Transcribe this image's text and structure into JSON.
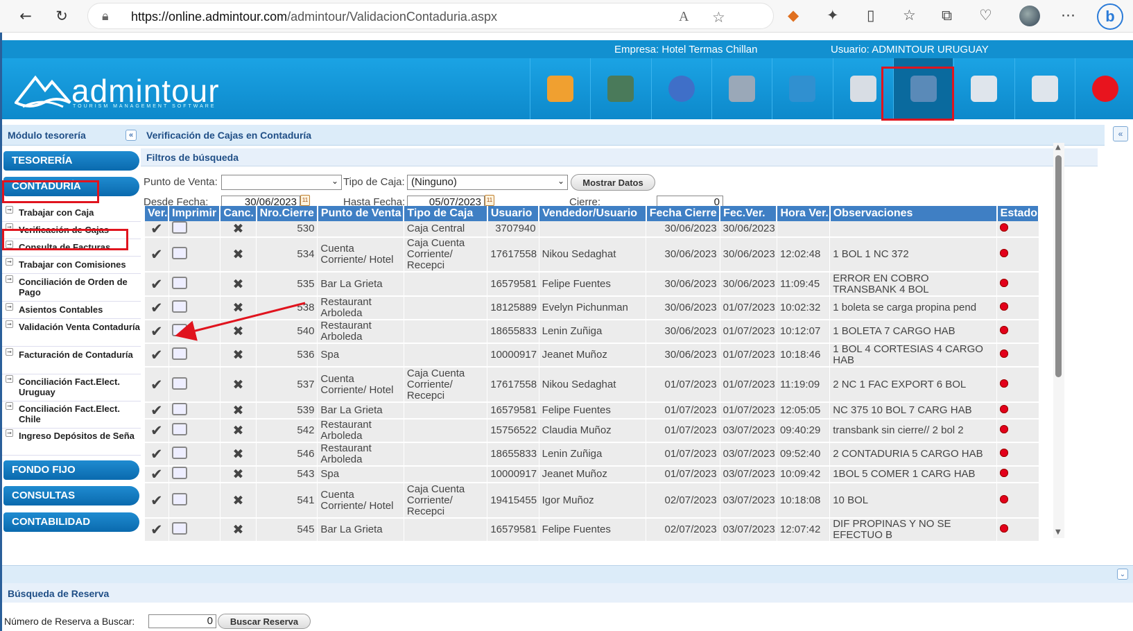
{
  "browser": {
    "url_host": "https://online.admintour.com",
    "url_path": "/admintour/ValidacionContaduria.aspx",
    "read_aloud": "A",
    "bing": "b"
  },
  "header": {
    "empresa": "Empresa: Hotel Termas Chillan",
    "usuario": "Usuario: ADMINTOUR URUGUAY",
    "logo_text": "admintour",
    "logo_sub": "TOURISM MANAGEMENT SOFTWARE",
    "modules": [
      {
        "icon": "home-icon",
        "color": "#f0a030"
      },
      {
        "icon": "building-icon",
        "color": "#4a7a5a"
      },
      {
        "icon": "restaurant-icon",
        "color": "#3f6fc8"
      },
      {
        "icon": "cart-icon",
        "color": "#9aa8b8"
      },
      {
        "icon": "user-desk-icon",
        "color": "#3090d0"
      },
      {
        "icon": "bank-icon",
        "color": "#d8dde4"
      },
      {
        "icon": "piggy-bank-icon",
        "color": "#5a8ab8"
      },
      {
        "icon": "calculator-icon",
        "color": "#dfe5ec"
      },
      {
        "icon": "tools-icon",
        "color": "#dfe5ec"
      },
      {
        "icon": "power-icon",
        "color": "#e8141e"
      }
    ]
  },
  "sidebar": {
    "title": "Módulo tesorería",
    "sections": {
      "tesoreria": "TESORERÍA",
      "contaduria": "CONTADURÍA",
      "fondo_fijo": "FONDO FIJO",
      "consultas": "CONSULTAS",
      "contabilidad": "CONTABILIDAD"
    },
    "items": [
      "Trabajar con Caja",
      "Verificación de Cajas",
      "Consulta de Facturas",
      "Trabajar con Comisiones",
      "Conciliación de Orden de Pago",
      "Asientos Contables",
      "Validación Venta Contaduría",
      "Facturación de Contaduría",
      "Conciliación Fact.Elect. Uruguay",
      "Conciliación Fact.Elect. Chile",
      "Ingreso Depósitos de Seña"
    ]
  },
  "main": {
    "title": "Verificación de Cajas en Contaduría",
    "filters": {
      "title": "Filtros de búsqueda",
      "punto_venta_label": "Punto de Venta:",
      "punto_venta_value": "",
      "tipo_caja_label": "Tipo de Caja:",
      "tipo_caja_value": "(Ninguno)",
      "mostrar_btn": "Mostrar Datos",
      "desde_label": "Desde Fecha:",
      "desde_value": "30/06/2023",
      "hasta_label": "Hasta Fecha:",
      "hasta_value": "05/07/2023",
      "cierre_label": "Cierre:",
      "cierre_value": "0"
    },
    "columns": [
      "Ver.",
      "Imprimir",
      "Canc.",
      "Nro.Cierre",
      "Punto de Venta",
      "Tipo de Caja",
      "Usuario",
      "Vendedor/Usuario",
      "Fecha Cierre",
      "Fec.Ver.",
      "Hora Ver.",
      "Observaciones",
      "Estado"
    ],
    "rows": [
      {
        "cierre": "530",
        "punto": "",
        "tipo": "Caja Central",
        "usuario": "3707940",
        "vendedor": "",
        "fecha": "30/06/2023",
        "fecver": "30/06/2023",
        "hora": "",
        "obs": ""
      },
      {
        "cierre": "534",
        "punto": "Cuenta Corriente/ Hotel",
        "tipo": "Caja Cuenta Corriente/ Recepci",
        "usuario": "17617558",
        "vendedor": "Nikou Sedaghat",
        "fecha": "30/06/2023",
        "fecver": "30/06/2023",
        "hora": "12:02:48",
        "obs": "1 BOL 1 NC 372"
      },
      {
        "cierre": "535",
        "punto": "Bar La Grieta",
        "tipo": "",
        "usuario": "16579581",
        "vendedor": "Felipe Fuentes",
        "fecha": "30/06/2023",
        "fecver": "30/06/2023",
        "hora": "11:09:45",
        "obs": "ERROR EN COBRO TRANSBANK 4 BOL"
      },
      {
        "cierre": "538",
        "punto": "Restaurant Arboleda",
        "tipo": "",
        "usuario": "18125889",
        "vendedor": "Evelyn Pichunman",
        "fecha": "30/06/2023",
        "fecver": "01/07/2023",
        "hora": "10:02:32",
        "obs": "1 boleta se carga propina pend"
      },
      {
        "cierre": "540",
        "punto": "Restaurant Arboleda",
        "tipo": "",
        "usuario": "18655833",
        "vendedor": "Lenin Zuñiga",
        "fecha": "30/06/2023",
        "fecver": "01/07/2023",
        "hora": "10:12:07",
        "obs": "1 BOLETA 7 CARGO HAB"
      },
      {
        "cierre": "536",
        "punto": "Spa",
        "tipo": "",
        "usuario": "10000917",
        "vendedor": "Jeanet Muñoz",
        "fecha": "30/06/2023",
        "fecver": "01/07/2023",
        "hora": "10:18:46",
        "obs": "1 BOL 4 CORTESIAS 4 CARGO HAB"
      },
      {
        "cierre": "537",
        "punto": "Cuenta Corriente/ Hotel",
        "tipo": "Caja Cuenta Corriente/ Recepci",
        "usuario": "17617558",
        "vendedor": "Nikou Sedaghat",
        "fecha": "01/07/2023",
        "fecver": "01/07/2023",
        "hora": "11:19:09",
        "obs": "2 NC 1 FAC EXPORT 6 BOL"
      },
      {
        "cierre": "539",
        "punto": "Bar La Grieta",
        "tipo": "",
        "usuario": "16579581",
        "vendedor": "Felipe Fuentes",
        "fecha": "01/07/2023",
        "fecver": "01/07/2023",
        "hora": "12:05:05",
        "obs": "NC 375 10 BOL 7 CARG HAB"
      },
      {
        "cierre": "542",
        "punto": "Restaurant Arboleda",
        "tipo": "",
        "usuario": "15756522",
        "vendedor": "Claudia Muñoz",
        "fecha": "01/07/2023",
        "fecver": "03/07/2023",
        "hora": "09:40:29",
        "obs": "transbank sin cierre// 2 bol 2"
      },
      {
        "cierre": "546",
        "punto": "Restaurant Arboleda",
        "tipo": "",
        "usuario": "18655833",
        "vendedor": "Lenin Zuñiga",
        "fecha": "01/07/2023",
        "fecver": "03/07/2023",
        "hora": "09:52:40",
        "obs": "2 CONTADURIA 5 CARGO HAB"
      },
      {
        "cierre": "543",
        "punto": "Spa",
        "tipo": "",
        "usuario": "10000917",
        "vendedor": "Jeanet Muñoz",
        "fecha": "01/07/2023",
        "fecver": "03/07/2023",
        "hora": "10:09:42",
        "obs": "1BOL 5 COMER 1 CARG HAB"
      },
      {
        "cierre": "541",
        "punto": "Cuenta Corriente/ Hotel",
        "tipo": "Caja Cuenta Corriente/ Recepci",
        "usuario": "19415455",
        "vendedor": "Igor Muñoz",
        "fecha": "02/07/2023",
        "fecver": "03/07/2023",
        "hora": "10:18:08",
        "obs": "10 BOL"
      },
      {
        "cierre": "545",
        "punto": "Bar La Grieta",
        "tipo": "",
        "usuario": "16579581",
        "vendedor": "Felipe Fuentes",
        "fecha": "02/07/2023",
        "fecver": "03/07/2023",
        "hora": "12:07:42",
        "obs": "DIF PROPINAS Y NO SE EFECTUO B"
      }
    ]
  },
  "reserva": {
    "title": "Búsqueda de Reserva",
    "label": "Número de Reserva a Buscar:",
    "value": "0",
    "button": "Buscar Reserva"
  }
}
